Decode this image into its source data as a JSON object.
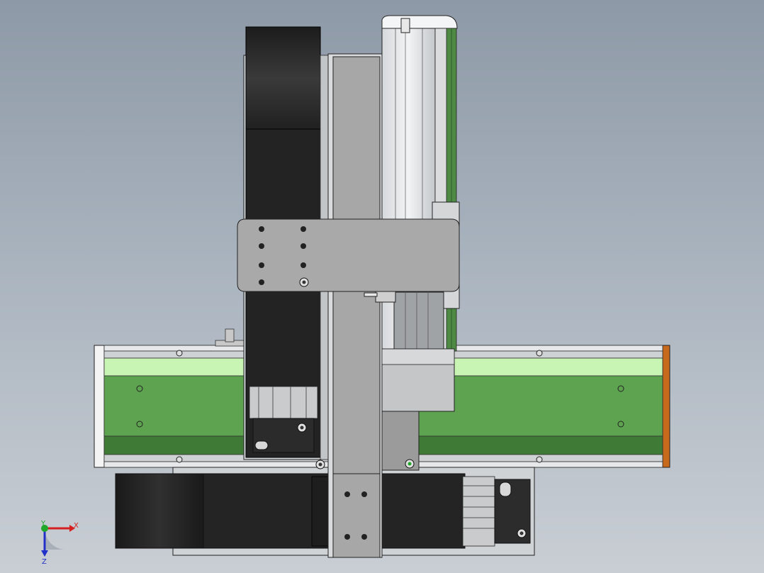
{
  "viewport": {
    "background_top": "#8e99a7",
    "background_bottom": "#c9ced4"
  },
  "model": {
    "accent_green": "#5ea34f",
    "light_green": "#c9f5b4",
    "dark_green": "#3f7a36",
    "motor_black": "#262626",
    "aluminum": "#bfc3c6",
    "plate_gray": "#a9a9a9",
    "orange_cap": "#c86a1c"
  },
  "triad": {
    "x_label": "X",
    "y_label": "Y",
    "z_label": "Z",
    "x_color": "#d62020",
    "y_color": "#1fa82a",
    "z_color": "#2030c8"
  }
}
